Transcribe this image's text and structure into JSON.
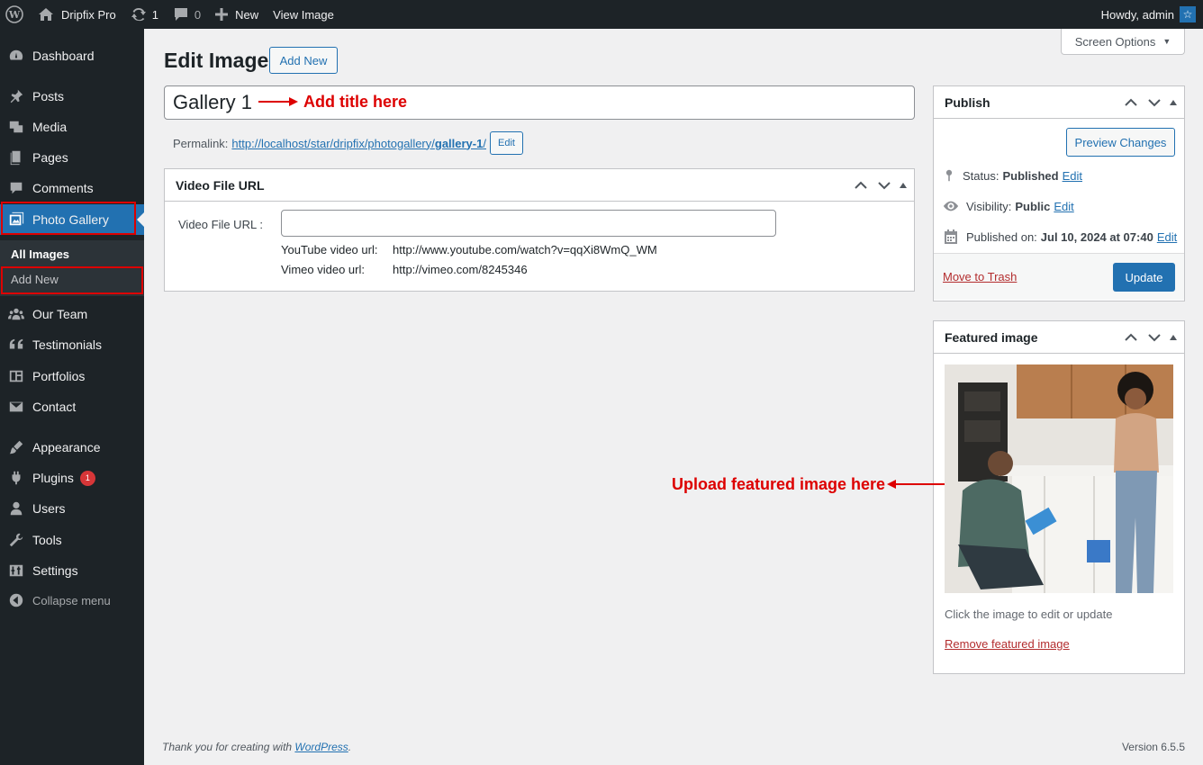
{
  "adminbar": {
    "site_name": "Dripfix Pro",
    "updates_count": "1",
    "comments_count": "0",
    "new_label": "New",
    "view_label": "View Image",
    "howdy": "Howdy, admin"
  },
  "sidebar": {
    "items": [
      {
        "label": "Dashboard",
        "icon": "dashboard-icon"
      },
      {
        "label": "Posts",
        "icon": "pin-icon"
      },
      {
        "label": "Media",
        "icon": "media-icon"
      },
      {
        "label": "Pages",
        "icon": "pages-icon"
      },
      {
        "label": "Comments",
        "icon": "comment-icon"
      },
      {
        "label": "Photo Gallery",
        "icon": "gallery-icon"
      },
      {
        "label": "Our Team",
        "icon": "team-icon"
      },
      {
        "label": "Testimonials",
        "icon": "quote-icon"
      },
      {
        "label": "Portfolios",
        "icon": "portfolio-icon"
      },
      {
        "label": "Contact",
        "icon": "mail-icon"
      },
      {
        "label": "Appearance",
        "icon": "brush-icon"
      },
      {
        "label": "Plugins",
        "icon": "plug-icon",
        "badge": "1"
      },
      {
        "label": "Users",
        "icon": "user-icon"
      },
      {
        "label": "Tools",
        "icon": "wrench-icon"
      },
      {
        "label": "Settings",
        "icon": "settings-icon"
      }
    ],
    "submenu": [
      "All Images",
      "Add New"
    ],
    "collapse": "Collapse menu"
  },
  "page": {
    "title": "Edit Image",
    "add_new": "Add New",
    "screen_options": "Screen Options",
    "post_title": "Gallery 1",
    "annotation_title": "Add title here",
    "permalink_label": "Permalink:",
    "permalink_base": "http://localhost/star/dripfix/photogallery/",
    "permalink_slug": "gallery-1",
    "permalink_end": "/",
    "permalink_edit": "Edit"
  },
  "video_box": {
    "title": "Video File URL",
    "field_label": "Video File URL :",
    "value": "",
    "youtube_label": "YouTube video url:",
    "youtube_example": "http://www.youtube.com/watch?v=qqXi8WmQ_WM",
    "vimeo_label": "Vimeo video url:",
    "vimeo_example": "http://vimeo.com/8245346"
  },
  "publish": {
    "title": "Publish",
    "preview": "Preview Changes",
    "status_label": "Status:",
    "status_value": "Published",
    "visibility_label": "Visibility:",
    "visibility_value": "Public",
    "published_label": "Published on:",
    "published_value": "Jul 10, 2024 at 07:40",
    "edit": "Edit",
    "trash": "Move to Trash",
    "update": "Update"
  },
  "featured": {
    "title": "Featured image",
    "help": "Click the image to edit or update",
    "remove": "Remove featured image",
    "annotation": "Upload featured image here"
  },
  "footer": {
    "thanks_prefix": "Thank you for creating with ",
    "thanks_link": "WordPress",
    "thanks_suffix": ".",
    "version": "Version 6.5.5"
  },
  "colors": {
    "accent": "#2271b1",
    "sidebar_bg": "#1d2327",
    "annotation": "#dd0000"
  }
}
